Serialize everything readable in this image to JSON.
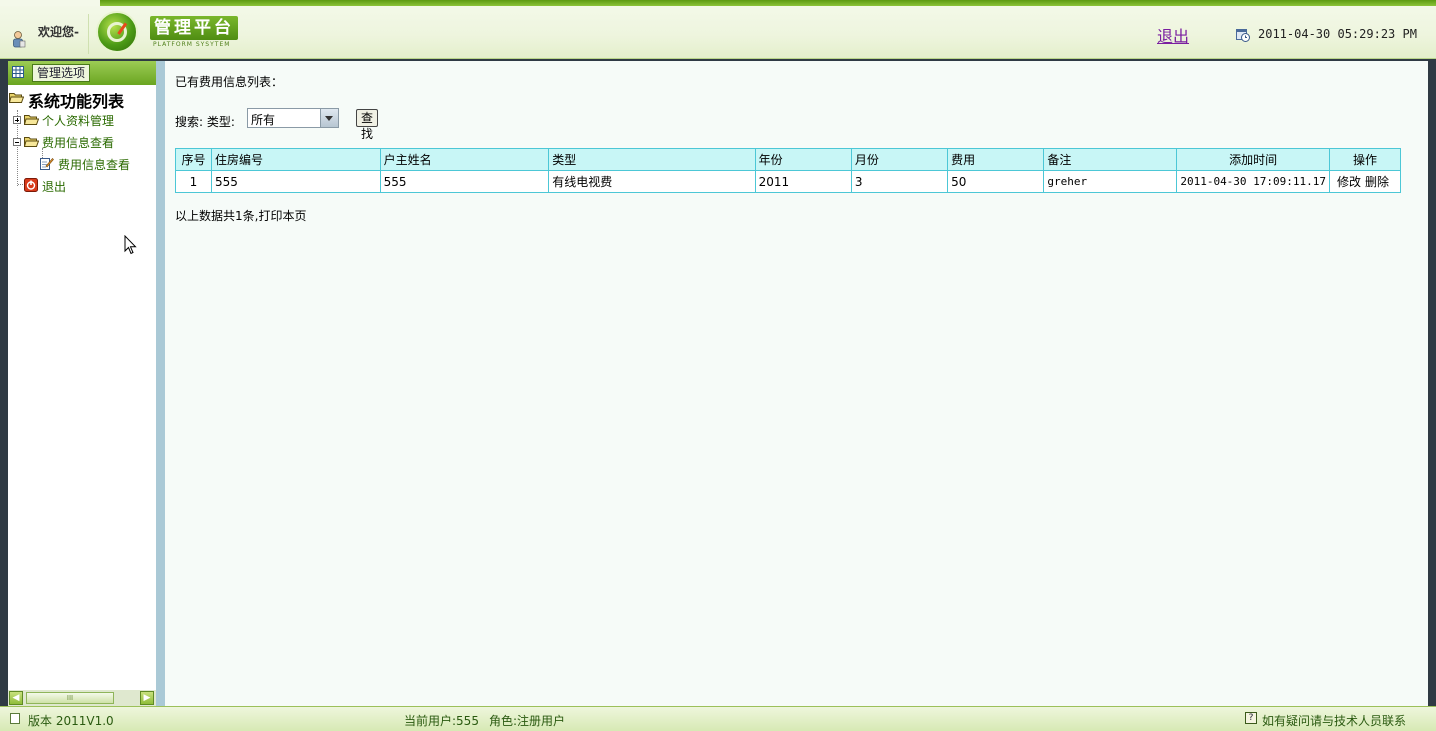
{
  "header": {
    "welcome": "欢迎您-",
    "platform_title": "管理平台",
    "platform_subtitle": "PLATFORM SYSYTEM",
    "logout": "退出",
    "datetime": "2011-04-30 05:29:23 PM"
  },
  "sidebar": {
    "manage_button": "管理选项",
    "root": "系统功能列表",
    "items": [
      {
        "label": "个人资料管理"
      },
      {
        "label": "费用信息查看"
      },
      {
        "label": "费用信息查看"
      },
      {
        "label": "退出"
      }
    ],
    "scroll_thumb": "III"
  },
  "main": {
    "list_title": "已有费用信息列表：",
    "search_label": "搜索: 类型:",
    "type_selected": "所有",
    "find_button": "查找",
    "columns": [
      "序号",
      "住房编号",
      "户主姓名",
      "类型",
      "年份",
      "月份",
      "费用",
      "备注",
      "添加时间",
      "操作"
    ],
    "rows": [
      {
        "no": "1",
        "house": "555",
        "owner": "555",
        "type": "有线电视费",
        "year": "2011",
        "month": "3",
        "fee": "50",
        "note": "greher",
        "added": "2011-04-30 17:09:11.17",
        "edit": "修改",
        "delete": "删除"
      }
    ],
    "summary": "以上数据共1条,打印本页"
  },
  "footer": {
    "version": "版本 2011V1.0",
    "current_user": "当前用户:555",
    "role": "角色:注册用户",
    "help": "如有疑问请与技术人员联系"
  },
  "colors": {
    "accent_green": "#6aa521",
    "table_border": "#4cc7d6",
    "table_header": "#c8f6f6"
  }
}
